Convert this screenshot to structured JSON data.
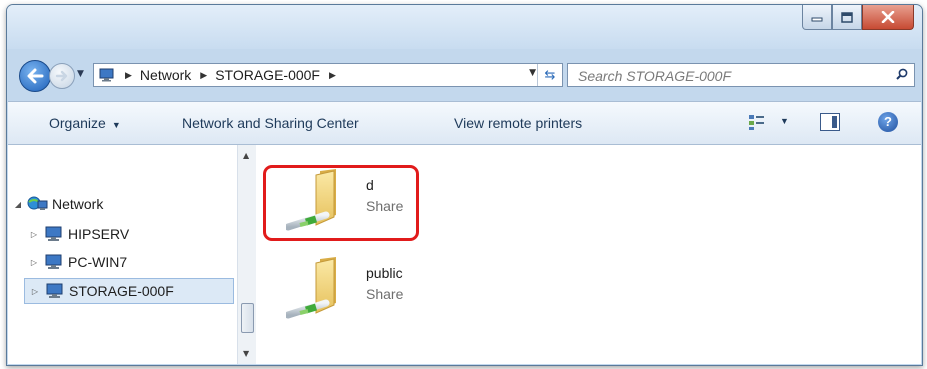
{
  "window": {
    "controls": {
      "minimize_icon": "minimize-icon",
      "maximize_icon": "maximize-icon",
      "close_icon": "close-icon"
    }
  },
  "address_bar": {
    "breadcrumbs": [
      "Network",
      "STORAGE-000F"
    ],
    "search_placeholder": "Search STORAGE-000F"
  },
  "toolbar": {
    "organize_label": "Organize",
    "network_sharing_label": "Network and Sharing Center",
    "view_printers_label": "View remote printers"
  },
  "nav_pane": {
    "root_label": "Network",
    "items": [
      {
        "label": "HIPSERV",
        "selected": false
      },
      {
        "label": "PC-WIN7",
        "selected": false
      },
      {
        "label": "STORAGE-000F",
        "selected": true
      }
    ]
  },
  "content": {
    "shares": [
      {
        "name": "d",
        "type": "Share",
        "highlighted": true
      },
      {
        "name": "public",
        "type": "Share",
        "highlighted": false
      }
    ]
  },
  "colors": {
    "highlight": "#e11b1b",
    "accent": "#1c5fb8"
  }
}
